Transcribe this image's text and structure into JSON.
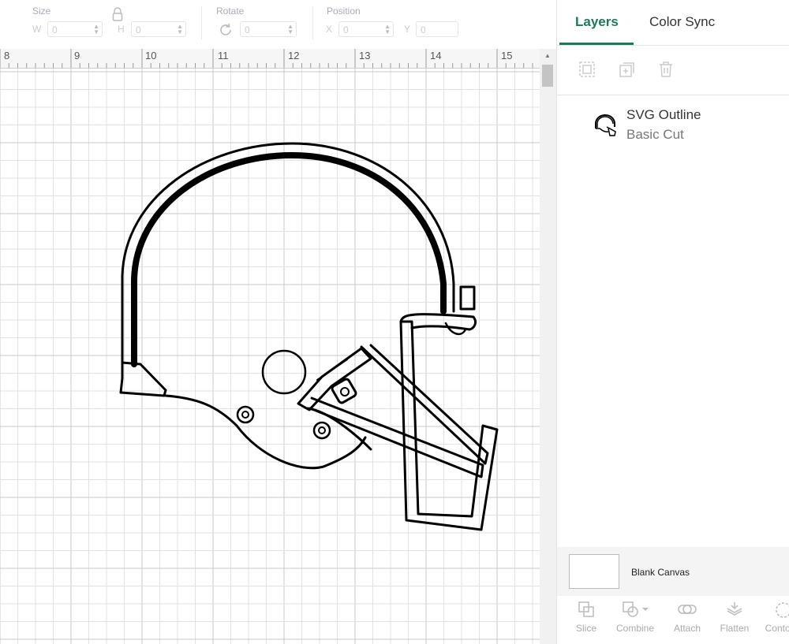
{
  "toolbar": {
    "size": {
      "label": "Size",
      "w_letter": "W",
      "w_value": "0",
      "h_letter": "H",
      "h_value": "0"
    },
    "rotate": {
      "label": "Rotate",
      "value": "0"
    },
    "position": {
      "label": "Position",
      "x_letter": "X",
      "x_value": "0",
      "y_letter": "Y",
      "y_value": "0"
    }
  },
  "ruler": {
    "numbers": [
      "8",
      "9",
      "10",
      "11",
      "12",
      "13",
      "14",
      "15"
    ]
  },
  "panel": {
    "tabs": {
      "layers": "Layers",
      "color_sync": "Color Sync"
    },
    "layer": {
      "name": "SVG Outline",
      "operation": "Basic Cut"
    },
    "canvas_label": "Blank Canvas",
    "actions": {
      "slice": "Slice",
      "combine": "Combine",
      "attach": "Attach",
      "flatten": "Flatten",
      "contour": "Contour"
    }
  },
  "icons": [
    "group-icon",
    "duplicate-icon",
    "delete-icon",
    "lock-icon",
    "rotate-icon",
    "helmet-thumbnail-icon"
  ],
  "colors": {
    "accent": "#1b7a5a",
    "muted": "#aaaaaa"
  }
}
